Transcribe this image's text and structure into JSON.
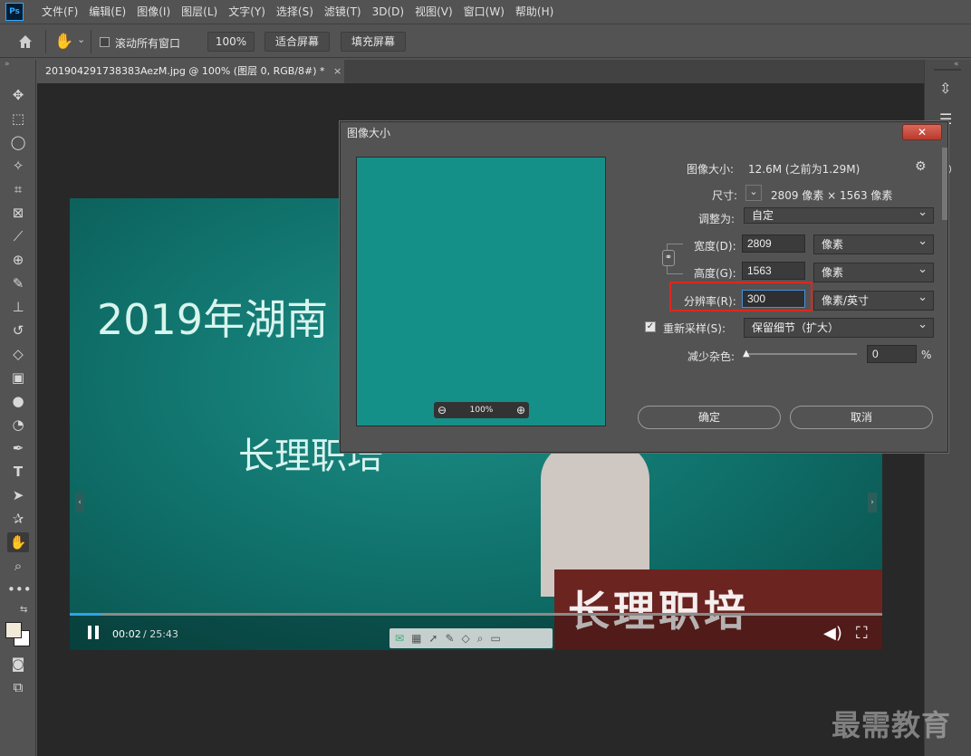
{
  "app": {
    "logo": "Ps"
  },
  "menu": [
    "文件(F)",
    "编辑(E)",
    "图像(I)",
    "图层(L)",
    "文字(Y)",
    "选择(S)",
    "滤镜(T)",
    "3D(D)",
    "视图(V)",
    "窗口(W)",
    "帮助(H)"
  ],
  "options": {
    "scroll_all_label": "滚动所有窗口",
    "zoom_value": "100%",
    "fit_screen": "适合屏幕",
    "fill_screen": "填充屏幕"
  },
  "document": {
    "tab_title": "201904291738383AezM.jpg @ 100% (图层 0, RGB/8#) *",
    "tab_close": "×"
  },
  "video": {
    "title_line1": "2019年湖南",
    "title_line2": "长理职培",
    "podium_text": "长理职培",
    "time_current": "00:02",
    "time_total": "/ 25:43",
    "progress_fraction": 0.0013
  },
  "dialog": {
    "title": "图像大小",
    "close": "✕",
    "image_size_label": "图像大小:",
    "image_size_value": "12.6M (之前为1.29M)",
    "dimensions_label": "尺寸:",
    "dimensions_value": "2809 像素  ×  1563 像素",
    "fit_to_label": "调整为:",
    "fit_to_value": "自定",
    "width_label": "宽度(D):",
    "width_value": "2809",
    "width_unit": "像素",
    "height_label": "高度(G):",
    "height_value": "1563",
    "height_unit": "像素",
    "resolution_label": "分辨率(R):",
    "resolution_value": "300",
    "resolution_unit": "像素/英寸",
    "resample_label": "重新采样(S):",
    "resample_value": "保留细节（扩大）",
    "noise_label": "减少杂色:",
    "noise_value": "0",
    "noise_unit": "%",
    "preview_zoom": "100%",
    "ok": "确定",
    "cancel": "取消"
  },
  "watermark": "最需教育"
}
